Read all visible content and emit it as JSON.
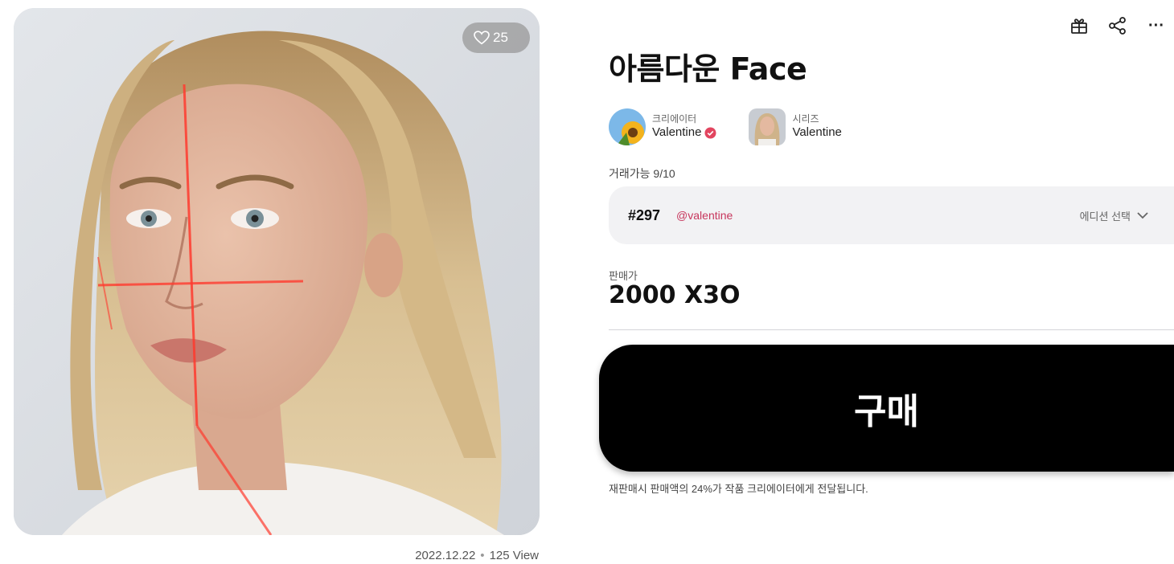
{
  "artwork": {
    "likes": "25",
    "date": "2022.12.22",
    "separator": "•",
    "views": "125 View"
  },
  "toolbar": {
    "icons": [
      "gift-icon",
      "share-icon",
      "more-icon"
    ],
    "more": "···"
  },
  "title": "아름다운 Face",
  "creator": {
    "label": "크리에이터",
    "name": "Valentine"
  },
  "series": {
    "label": "시리즈",
    "name": "Valentine"
  },
  "availability": "거래가능 9/10",
  "edition": {
    "number": "#297",
    "handle": "@valentine",
    "select_label": "에디션 선택"
  },
  "price": {
    "label": "판매가",
    "value": "2000 X3O"
  },
  "buy_button": "구매",
  "royalty_notice": "재판매시 판매액의 24%가 작품 크리에이터에게 전달됩니다.",
  "colors": {
    "accent": "#c7365c",
    "verified": "#e2455f",
    "button": "#000000",
    "edition_bg": "#f2f2f4"
  }
}
